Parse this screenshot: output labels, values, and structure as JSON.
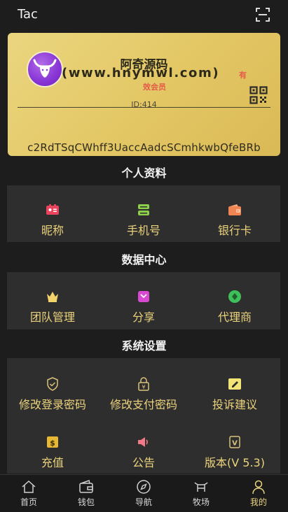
{
  "app": {
    "title": "Tac"
  },
  "card": {
    "name": "阿奇源码",
    "site": "(www.hnymwl.com)",
    "member_part1": "有",
    "member_part2": "效会员",
    "uid": "ID:414",
    "code": "c2RdTSqCWhff3UaccAadcSCmhkwbQfeBRb"
  },
  "profile": {
    "title": "个人资料",
    "items": [
      {
        "label": "昵称",
        "icon": "id-card-icon"
      },
      {
        "label": "手机号",
        "icon": "phone-icon"
      },
      {
        "label": "银行卡",
        "icon": "wallet-icon"
      }
    ]
  },
  "data_center": {
    "title": "数据中心",
    "items": [
      {
        "label": "团队管理",
        "icon": "crown-icon"
      },
      {
        "label": "分享",
        "icon": "share-icon"
      },
      {
        "label": "代理商",
        "icon": "agent-icon"
      }
    ]
  },
  "settings": {
    "title": "系统设置",
    "items": [
      {
        "label": "修改登录密码",
        "icon": "shield-icon"
      },
      {
        "label": "修改支付密码",
        "icon": "lock-icon"
      },
      {
        "label": "投诉建议",
        "icon": "edit-icon"
      },
      {
        "label": "充值",
        "icon": "recharge-icon"
      },
      {
        "label": "公告",
        "icon": "speaker-icon"
      },
      {
        "label": "版本(V 5.3)",
        "icon": "version-icon"
      }
    ]
  },
  "tabbar": {
    "items": [
      {
        "label": "首页",
        "icon": "home-icon"
      },
      {
        "label": "钱包",
        "icon": "wallet-icon"
      },
      {
        "label": "导航",
        "icon": "compass-icon"
      },
      {
        "label": "牧场",
        "icon": "ranch-icon"
      },
      {
        "label": "我的",
        "icon": "user-icon"
      }
    ],
    "active_label": "我的"
  },
  "colors": {
    "gold": "#ebd27c",
    "card_gold": "#e4c866",
    "panel": "#2e2e2e",
    "background": "#1d1d1d",
    "member_red": "#e45b4a"
  }
}
